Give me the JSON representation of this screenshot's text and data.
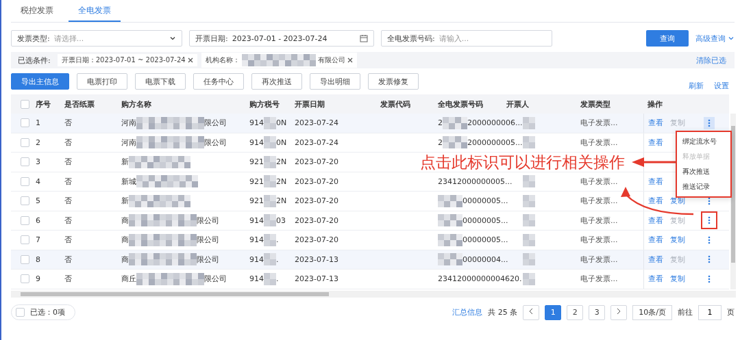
{
  "tabs": [
    {
      "label": "税控发票",
      "selected": false
    },
    {
      "label": "全电发票",
      "selected": true
    }
  ],
  "filters": [
    {
      "kind": "select",
      "label": "发票类型:",
      "placeholder": "请选择..."
    },
    {
      "kind": "date",
      "label": "开票日期:",
      "value": "2023-07-01 - 2023-07-24"
    },
    {
      "kind": "text",
      "label": "全电发票号码:",
      "placeholder": "请输入..."
    }
  ],
  "search_button": "查询",
  "advanced_link": "高级查询",
  "conditions": {
    "label": "已选条件:",
    "tags": [
      {
        "label": "开票日期：2023-07-01 ~ 2023-07-24",
        "redacted": false
      },
      {
        "label": "机构名称：",
        "suffix": "有限公司",
        "redacted": true
      }
    ],
    "clear": "清除已选"
  },
  "toolbar": [
    {
      "label": "导出主信息",
      "primary": true
    },
    {
      "label": "电票打印",
      "primary": false
    },
    {
      "label": "电票下载",
      "primary": false
    },
    {
      "label": "任务中心",
      "primary": false
    },
    {
      "label": "再次推送",
      "primary": false
    },
    {
      "label": "导出明细",
      "primary": false
    },
    {
      "label": "发票修复",
      "primary": false
    }
  ],
  "toolbar_links": [
    "刷新",
    "设置"
  ],
  "select_all": {
    "checked": false
  },
  "columns": [
    "序号",
    "是否纸票",
    "购方名称",
    "购方税号",
    "开票日期",
    "发票代码",
    "全电发票号码",
    "开票人",
    "发票类型",
    "操作"
  ],
  "rows": [
    {
      "checked": false,
      "index": "1",
      "paper": "否",
      "buyer": {
        "prefix": "河南",
        "suffix": "限公司"
      },
      "tax": {
        "prefix": "914",
        "suffix": "0N"
      },
      "date": "2023-07-24",
      "number": {
        "prefix": "2",
        "text": "2000000006..."
      },
      "type": "电子发票...",
      "view": "查看",
      "copy": "复制",
      "copy_enabled": false,
      "menu_open": true,
      "annotated": false,
      "highlighted": true
    },
    {
      "checked": false,
      "index": "2",
      "paper": "否",
      "buyer": {
        "prefix": "河南",
        "suffix": "限公司"
      },
      "tax": {
        "prefix": "914",
        "suffix": "0N"
      },
      "date": "2023-07-24",
      "number": {
        "prefix": "2",
        "text": "2000000005..."
      },
      "type": "电子发票...",
      "view": "查看",
      "highlighted": false
    },
    {
      "checked": false,
      "index": "3",
      "paper": "否",
      "buyer": {
        "prefix": "新"
      },
      "tax": {
        "prefix": "921",
        "suffix": "2N"
      },
      "date": "2023-07-20",
      "highlighted": false
    },
    {
      "checked": false,
      "index": "4",
      "paper": "否",
      "buyer": {
        "prefix": "新城"
      },
      "tax": {
        "prefix": "921",
        "suffix": "2N"
      },
      "date": "2023-07-20",
      "number": {
        "text": "23412000000005..."
      },
      "type": "电子发票...",
      "view": "查看",
      "highlighted": false
    },
    {
      "checked": false,
      "index": "5",
      "paper": "否",
      "buyer": {
        "prefix": "新"
      },
      "tax": {
        "prefix": "921",
        "suffix": "2N"
      },
      "date": "2023-07-20",
      "number": {
        "text": "00000005..."
      },
      "type": "电子发票...",
      "view": "查看",
      "copy": "复制",
      "copy_enabled": true,
      "menu_open": false,
      "annotated": false,
      "highlighted": false
    },
    {
      "checked": false,
      "index": "6",
      "paper": "否",
      "buyer": {
        "prefix": "商",
        "suffix": "限公司"
      },
      "tax": {
        "prefix": "914",
        "suffix": "03"
      },
      "date": "2023-07-20",
      "number": {
        "text": "00000005..."
      },
      "type": "电子发票...",
      "view": "查看",
      "copy": "复制",
      "copy_enabled": false,
      "menu_open": false,
      "annotated": true,
      "highlighted": false
    },
    {
      "checked": false,
      "index": "7",
      "paper": "否",
      "buyer": {
        "prefix": "商",
        "suffix": "限公司"
      },
      "tax": {
        "prefix": "914",
        "suffix": "."
      },
      "date": "2023-07-20",
      "number": {
        "text": "00000005..."
      },
      "type": "电子发票...",
      "view": "查看",
      "copy": "复制",
      "copy_enabled": true,
      "menu_open": false,
      "annotated": false,
      "highlighted": false
    },
    {
      "checked": false,
      "index": "8",
      "paper": "否",
      "buyer": {
        "prefix": "商",
        "suffix": "限公司"
      },
      "tax": {
        "prefix": "914",
        "suffix": "."
      },
      "date": "2023-07-13",
      "number": {
        "text": "00000004..."
      },
      "type": "电子发票...",
      "view": "查看",
      "copy": "复制",
      "copy_enabled": false,
      "menu_open": false,
      "annotated": false,
      "highlighted": true
    },
    {
      "checked": false,
      "index": "9",
      "paper": "否",
      "buyer": {
        "prefix": "商丘",
        "suffix": "限公司"
      },
      "tax": {
        "prefix": "914",
        "suffix": "."
      },
      "date": "2023-07-13",
      "number": {
        "text": "23412000000004620."
      },
      "type": "电子发票...",
      "view": "查看",
      "copy": "复制",
      "copy_enabled": true,
      "menu_open": false,
      "annotated": false,
      "highlighted": false
    }
  ],
  "action_menu": {
    "items": [
      {
        "label": "绑定流水号",
        "disabled": false
      },
      {
        "label": "释放单据",
        "disabled": true
      },
      {
        "label": "再次推送",
        "disabled": false
      },
      {
        "label": "推送记录",
        "disabled": false
      }
    ]
  },
  "annotation": {
    "text": "点击此标识可以进行相关操作"
  },
  "footer": {
    "checked": false,
    "selected": "已选：0项",
    "summary": "汇总信息",
    "total": "共 25 条",
    "pages": [
      {
        "label": "1",
        "selected": true
      },
      {
        "label": "2",
        "selected": false
      },
      {
        "label": "3",
        "selected": false
      }
    ],
    "page_size": "10条/页",
    "goto": "前往",
    "goto_value": "1",
    "page_unit": "页"
  }
}
